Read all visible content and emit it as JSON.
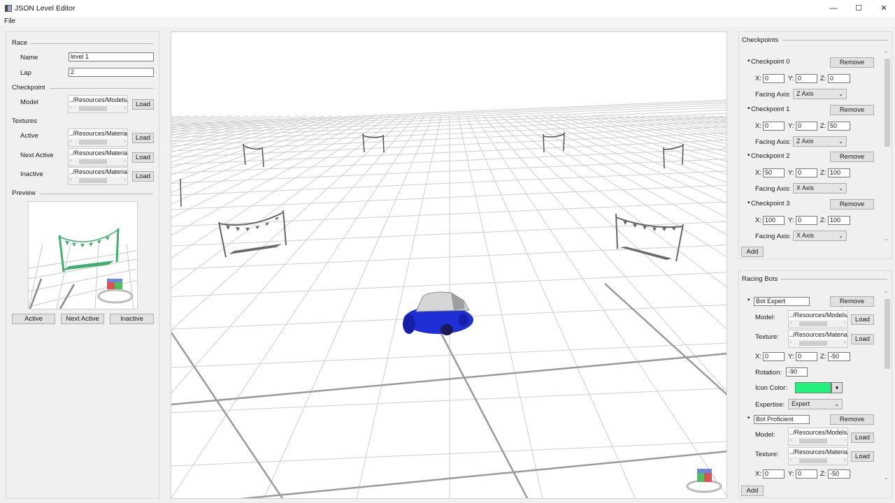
{
  "window": {
    "title": "JSON Level Editor",
    "minimize": "—",
    "maximize": "☐",
    "close": "✕"
  },
  "menu": {
    "file": "File"
  },
  "race": {
    "title": "Race",
    "name_label": "Name",
    "name_value": "level 1",
    "lap_label": "Lap",
    "lap_value": "2"
  },
  "checkpoint": {
    "title": "Checkpoint",
    "model_label": "Model",
    "model_path": "../Resources/Models/",
    "load": "Load"
  },
  "textures": {
    "title": "Textures",
    "active_label": "Active",
    "active_path": "../Resources/Materia",
    "next_label": "Next Active",
    "next_path": "../Resources/Materia",
    "inactive_label": "Inactive",
    "inactive_path": "../Resources/Materia",
    "load": "Load"
  },
  "preview": {
    "title": "Preview",
    "btn_active": "Active",
    "btn_next": "Next Active",
    "btn_inactive": "Inactive"
  },
  "checkpoints_panel": {
    "title": "Checkpoints",
    "remove": "Remove",
    "facing_label": "Facing Axis:",
    "add": "Add",
    "items": [
      {
        "name": "Checkpoint 0",
        "x": "0",
        "y": "0",
        "z": "0",
        "axis": "Z Axis"
      },
      {
        "name": "Checkpoint 1",
        "x": "0",
        "y": "0",
        "z": "50",
        "axis": "Z Axis"
      },
      {
        "name": "Checkpoint 2",
        "x": "50",
        "y": "0",
        "z": "100",
        "axis": "X Axis"
      },
      {
        "name": "Checkpoint 3",
        "x": "100",
        "y": "0",
        "z": "100",
        "axis": "X Axis"
      }
    ]
  },
  "bots_panel": {
    "title": "Racing Bots",
    "remove": "Remove",
    "load": "Load",
    "add": "Add",
    "model_label": "Model:",
    "texture_label": "Texture:",
    "rotation_label": "Rotation:",
    "icon_color_label": "Icon Color:",
    "expertise_label": "Expertise:",
    "bots": [
      {
        "name": "Bot Expert",
        "model_path": "../Resources/Models/",
        "texture_path": "../Resources/Materia",
        "x": "0",
        "y": "0",
        "z": "-50",
        "rotation": "-90",
        "icon_color": "#22f07a",
        "expertise": "Expert"
      },
      {
        "name": "Bot Proficient",
        "model_path": "../Resources/Models/",
        "texture_path": "../Resources/Materia",
        "x": "0",
        "y": "0",
        "z": "-50"
      }
    ]
  },
  "coord_labels": {
    "x": "X:",
    "y": "Y:",
    "z": "Z:"
  },
  "colors": {
    "accent_green": "#3fae6e",
    "car_blue": "#1f2fd6"
  }
}
